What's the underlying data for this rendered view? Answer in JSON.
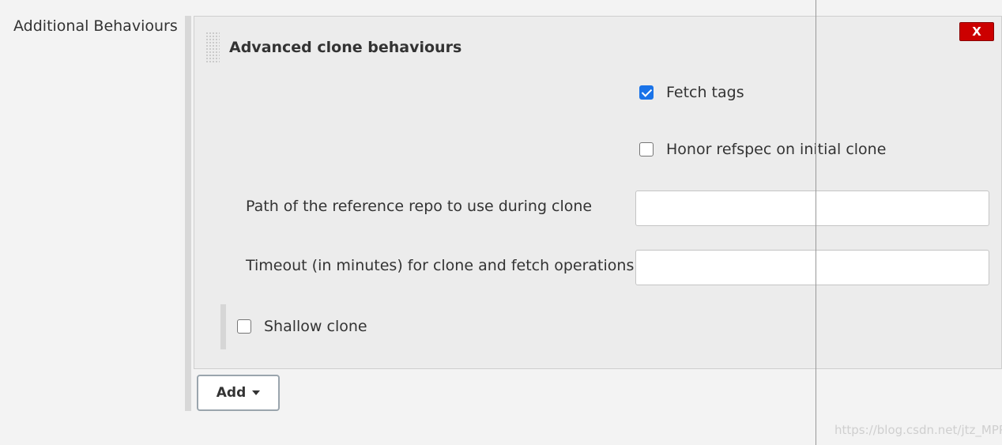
{
  "section": {
    "label": "Additional Behaviours"
  },
  "panel": {
    "title": "Advanced clone behaviours",
    "close_label": "X",
    "options": {
      "fetch_tags": {
        "label": "Fetch tags",
        "checked": true
      },
      "honor_refspec": {
        "label": "Honor refspec on initial clone",
        "checked": false
      },
      "shallow_clone": {
        "label": "Shallow clone",
        "checked": false
      }
    },
    "fields": {
      "reference_repo": {
        "label": "Path of the reference repo to use during clone",
        "value": ""
      },
      "timeout": {
        "label": "Timeout (in minutes) for clone and fetch operations",
        "value": ""
      }
    }
  },
  "add_button": {
    "label": "Add",
    "icon": "caret-down-icon"
  },
  "watermark": "https://blog.csdn.net/jtz_MPP",
  "colors": {
    "close_button": "#cc0000",
    "checkbox_checked": "#1a73e8",
    "panel_background": "#ececec",
    "page_background": "#f3f3f3"
  }
}
